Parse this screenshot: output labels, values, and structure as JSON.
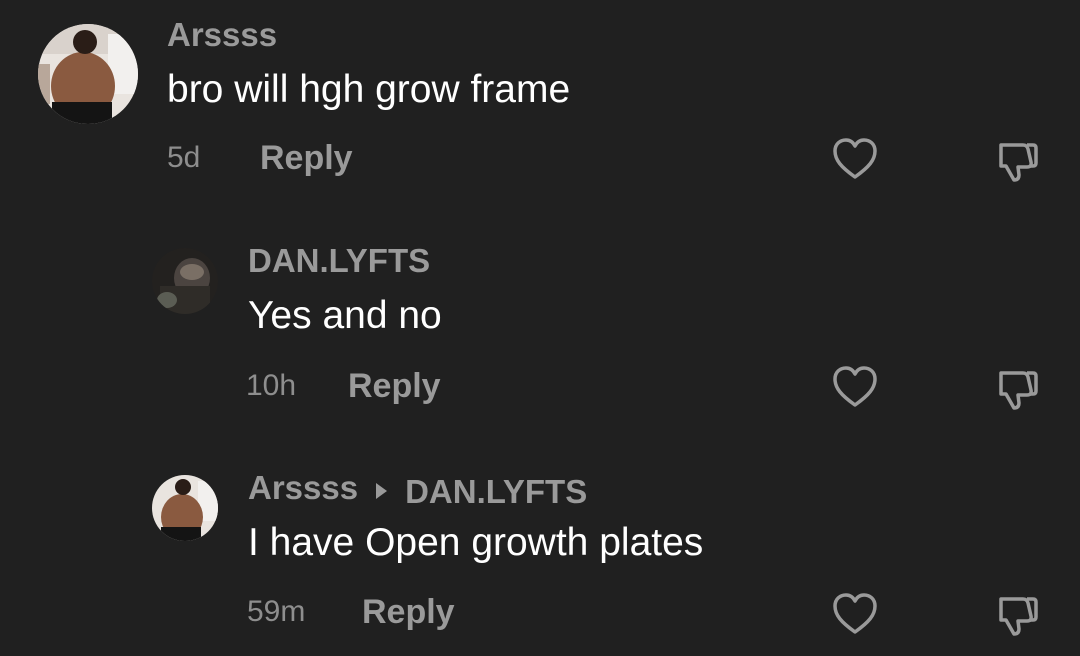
{
  "comments": [
    {
      "username": "Arssss",
      "text": "bro will hgh grow frame",
      "time": "5d",
      "reply_label": "Reply",
      "avatar_icon": "user-avatar"
    },
    {
      "username": "DAN.LYFTS",
      "text": "Yes and no",
      "time": "10h",
      "reply_label": "Reply",
      "avatar_icon": "user-avatar"
    },
    {
      "username": "Arssss",
      "reply_to": "DAN.LYFTS",
      "text": "I have Open growth plates",
      "time": "59m",
      "reply_label": "Reply",
      "avatar_icon": "user-avatar"
    }
  ],
  "icons": {
    "like": "heart-icon",
    "dislike": "thumbs-down-icon",
    "reply_arrow": "caret-right-icon"
  },
  "colors": {
    "background": "#202020",
    "username": "#9a9a9a",
    "text": "#ffffff",
    "meta": "#8e8e8e"
  }
}
